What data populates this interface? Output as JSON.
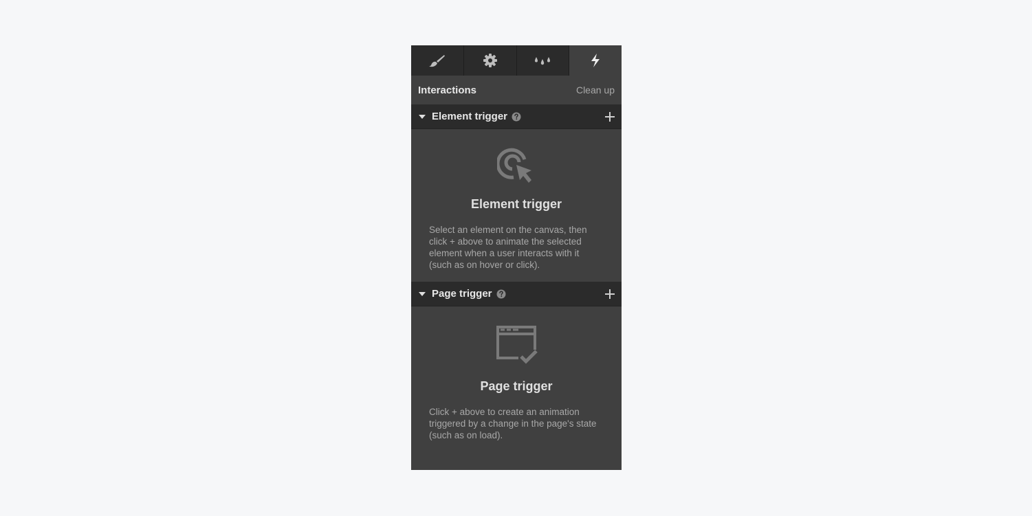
{
  "tabs": [
    {
      "name": "style-tab",
      "icon": "paintbrush-icon"
    },
    {
      "name": "settings-tab",
      "icon": "gear-icon"
    },
    {
      "name": "style-manager-tab",
      "icon": "droplets-icon"
    },
    {
      "name": "interactions-tab",
      "icon": "lightning-icon",
      "active": true
    }
  ],
  "header": {
    "title": "Interactions",
    "cleanup_label": "Clean up"
  },
  "element_trigger": {
    "section_label": "Element trigger",
    "heading": "Element trigger",
    "description": "Select an element on the canvas, then click + above to animate the selected element when a user interacts with it (such as on hover or click).",
    "icon": "cursor-click-icon"
  },
  "page_trigger": {
    "section_label": "Page trigger",
    "heading": "Page trigger",
    "description": "Click + above to create an animation triggered by a change in the page's state (such as on load).",
    "icon": "browser-window-check-icon"
  },
  "colors": {
    "panel_bg": "#404040",
    "header_bg": "#2b2b2b",
    "page_bg": "#f6f7f9",
    "icon_gray": "#757575"
  }
}
